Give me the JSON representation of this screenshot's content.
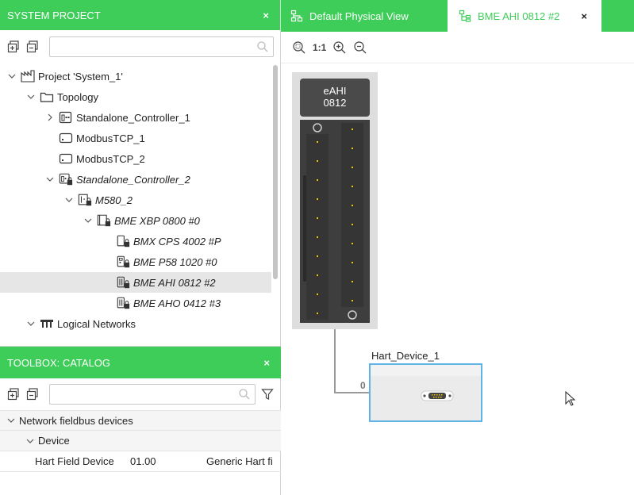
{
  "system_project": {
    "title": "SYSTEM PROJECT",
    "close": "×",
    "search_placeholder": "",
    "tree": [
      {
        "label": "Project 'System_1'",
        "italic": false,
        "selected": false
      },
      {
        "label": "Topology",
        "italic": false,
        "selected": false
      },
      {
        "label": "Standalone_Controller_1",
        "italic": false,
        "selected": false
      },
      {
        "label": "ModbusTCP_1",
        "italic": false,
        "selected": false
      },
      {
        "label": "ModbusTCP_2",
        "italic": false,
        "selected": false
      },
      {
        "label": "Standalone_Controller_2",
        "italic": true,
        "selected": false
      },
      {
        "label": "M580_2",
        "italic": true,
        "selected": false
      },
      {
        "label": "BME XBP 0800 #0",
        "italic": true,
        "selected": false
      },
      {
        "label": "BMX CPS 4002 #P",
        "italic": true,
        "selected": false
      },
      {
        "label": "BME P58 1020 #0",
        "italic": true,
        "selected": false
      },
      {
        "label": "BME AHI 0812 #2",
        "italic": true,
        "selected": true
      },
      {
        "label": "BME AHO 0412 #3",
        "italic": true,
        "selected": false
      },
      {
        "label": "Logical Networks",
        "italic": false,
        "selected": false
      }
    ]
  },
  "toolbox": {
    "title": "TOOLBOX: CATALOG",
    "close": "×",
    "search_placeholder": "",
    "group": "Network fieldbus devices",
    "subgroup": "Device",
    "item": {
      "name": "Hart Field Device",
      "version": "01.00",
      "description": "Generic Hart fi"
    }
  },
  "tabs": [
    {
      "label": "Default Physical View",
      "active": false
    },
    {
      "label": "BME AHI 0812 #2",
      "active": true,
      "close": "×"
    }
  ],
  "zoom": {
    "one_to_one": "1:1"
  },
  "diagram": {
    "module_label_line1": "eAHI",
    "module_label_line2": "0812",
    "device_name": "Hart_Device_1",
    "port_number": "0"
  },
  "colors": {
    "accent_green": "#3dcd58",
    "selection_blue": "#5fb3e6",
    "module_dark": "#3e3e3e",
    "pin_yellow": "#f0c400"
  }
}
